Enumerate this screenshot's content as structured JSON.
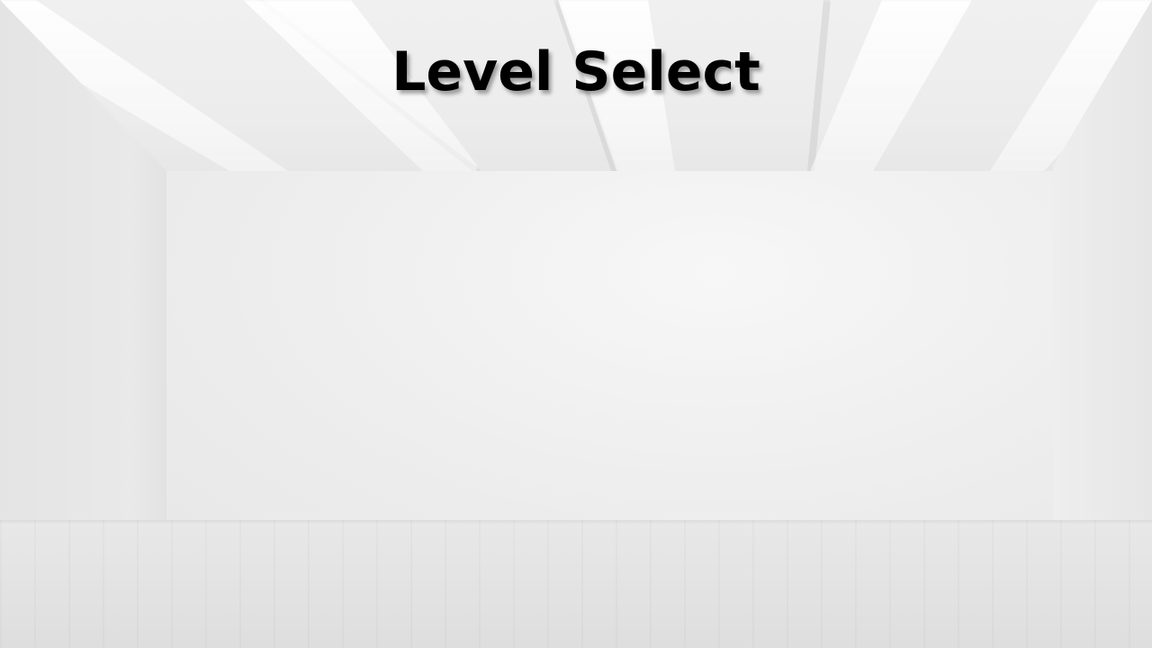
{
  "screen": {
    "title": "Level Select",
    "title_color": "#000000",
    "background_color": "#e9e9e9"
  }
}
